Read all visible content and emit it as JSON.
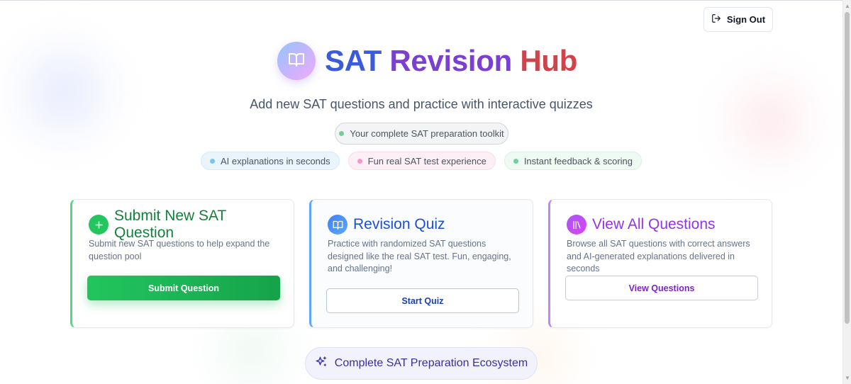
{
  "header": {
    "title_part1": "SAT",
    "title_part2": "Revision",
    "title_part3": "Hub",
    "subtitle": "Add new SAT questions and practice with interactive quizzes",
    "badge": "Your complete SAT preparation toolkit"
  },
  "actions": {
    "sign_out": "Sign Out"
  },
  "chips": [
    {
      "label": "AI explanations in seconds",
      "dot_color": "#7cc3ea"
    },
    {
      "label": "Fun real SAT test experience",
      "dot_color": "#f29ac6"
    },
    {
      "label": "Instant feedback & scoring",
      "dot_color": "#6fd09a"
    }
  ],
  "cards": {
    "submit": {
      "title": "Submit New SAT Question",
      "description": "Submit new SAT questions to help expand the question pool",
      "button": "Submit Question",
      "icon": "plus-icon"
    },
    "quiz": {
      "title": "Revision Quiz",
      "description": "Practice with randomized SAT questions designed like the real SAT test. Fun, engaging, and challenging!",
      "button": "Start Quiz",
      "icon": "book-open-icon"
    },
    "view": {
      "title": "View All Questions",
      "description": "Browse all SAT questions with correct answers and AI-generated explanations delivered in seconds",
      "button": "View Questions",
      "icon": "library-icon"
    }
  },
  "footer": {
    "ecosystem": "Complete SAT Preparation Ecosystem"
  },
  "colors": {
    "title_sat": "#3b5bdb",
    "title_revision": "#7b3fd1",
    "title_hub": "#d0434a",
    "green": "#22c55e",
    "blue": "#3b82f6",
    "purple": "#a855f7"
  }
}
